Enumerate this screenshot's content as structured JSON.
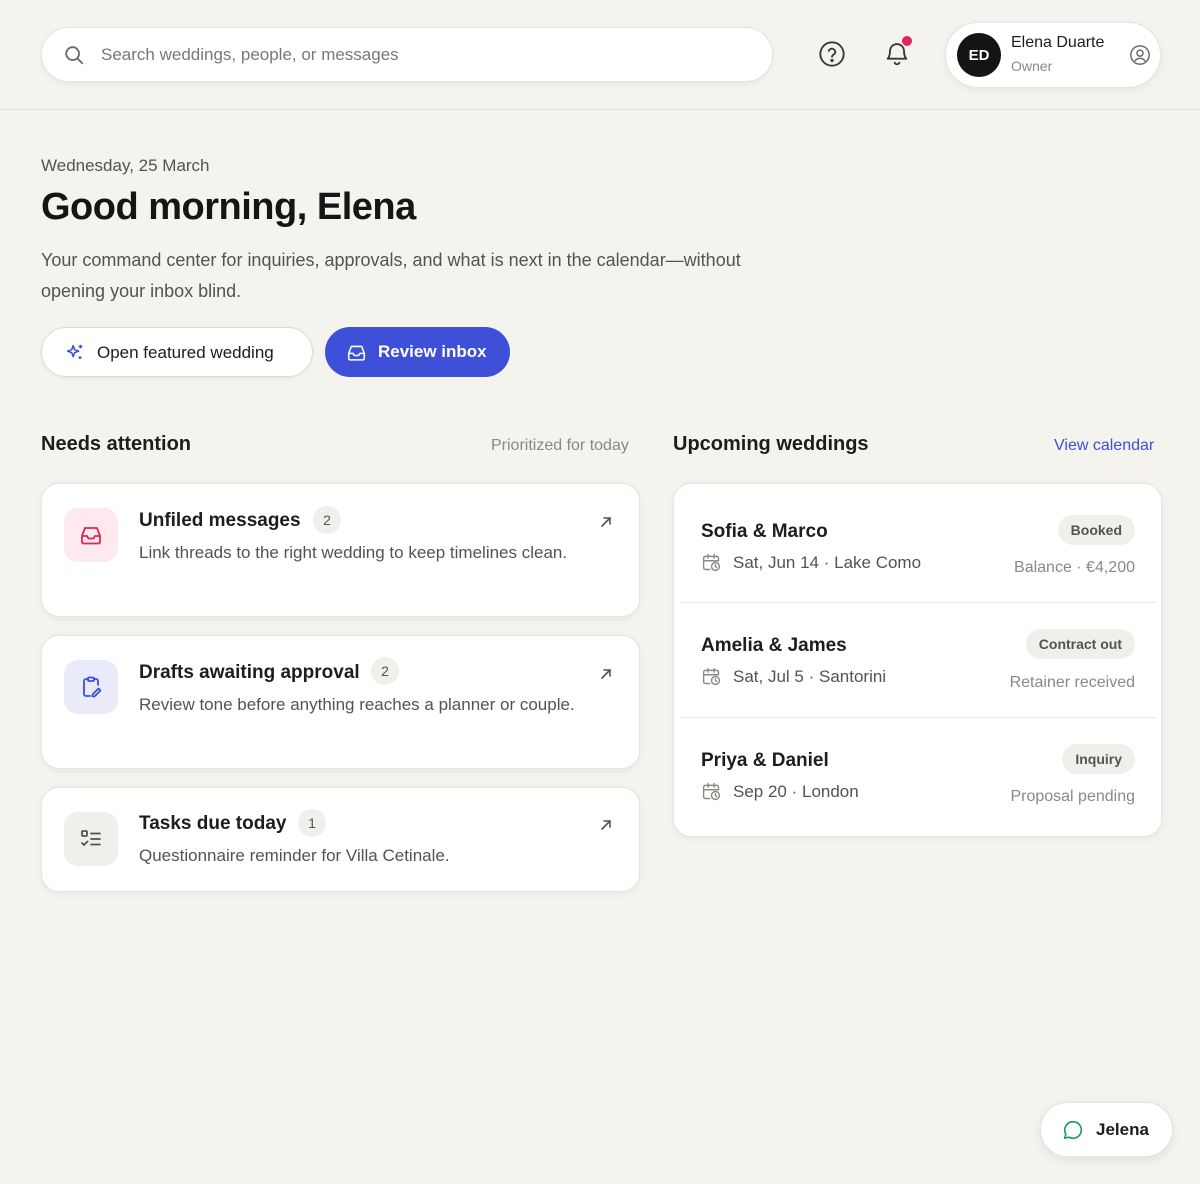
{
  "search": {
    "placeholder": "Search weddings, people, or messages",
    "icon": "search-icon"
  },
  "header": {
    "help_icon": "help-circle-icon",
    "notification_icon": "bell-icon",
    "notification_dot_color": "#e0245e",
    "user": {
      "initials": "ED",
      "name": "Elena Duarte",
      "role": "Owner",
      "menu_icon": "user-circle-icon"
    }
  },
  "hero": {
    "date": "Wednesday, 25 March",
    "greeting": "Good morning, Elena",
    "lede": "Your command center for inquiries, approvals, and what is next in the calendar—without opening your inbox blind.",
    "buttons": {
      "featured": "Open featured wedding",
      "inbox": "Review inbox"
    }
  },
  "attention": {
    "title": "Needs attention",
    "meta": "Prioritized for today",
    "items": [
      {
        "title": "Unfiled messages",
        "count": "2",
        "description": "Link threads to the right wedding to keep timelines clean.",
        "icon": "inbox-icon",
        "icon_color": "#e0245e",
        "icon_bg": "#fde9ee"
      },
      {
        "title": "Drafts awaiting approval",
        "count": "2",
        "description": "Review tone before anything reaches a planner or couple.",
        "icon": "clipboard-edit-icon",
        "icon_color": "#3e4fd8",
        "icon_bg": "#e9ebfb"
      },
      {
        "title": "Tasks due today",
        "count": "1",
        "description": "Questionnaire reminder for Villa Cetinale.",
        "icon": "checklist-icon",
        "icon_color": "#55534e",
        "icon_bg": "#f0efe9"
      }
    ]
  },
  "upcoming": {
    "title": "Upcoming weddings",
    "link": "View calendar",
    "items": [
      {
        "couple": "Sofia & Marco",
        "when": "Sat, Jun 14 · Lake Como",
        "status": "Booked",
        "note": "Balance · €4,200"
      },
      {
        "couple": "Amelia & James",
        "when": "Sat, Jul 5 · Santorini",
        "status": "Contract out",
        "note": "Retainer received"
      },
      {
        "couple": "Priya & Daniel",
        "when": "Sep 20 · London",
        "status": "Inquiry",
        "note": "Proposal pending"
      }
    ]
  },
  "chat": {
    "label": "Jelena",
    "icon": "chat-bubble-icon",
    "icon_color": "#1f9d55"
  },
  "colors": {
    "accent": "#3e4fd8",
    "background": "#f4f3ee"
  }
}
